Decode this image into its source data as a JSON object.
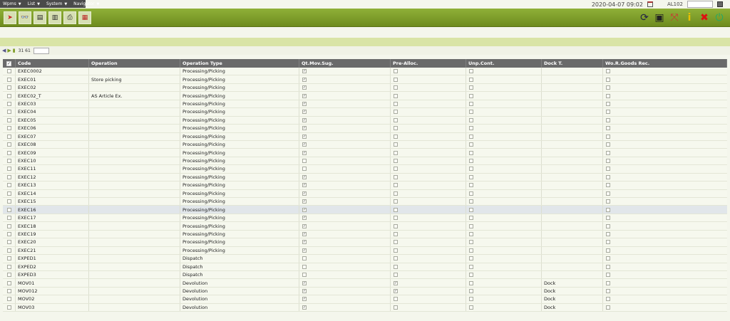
{
  "menu": [
    "Wpms",
    "List",
    "System",
    "Navigator"
  ],
  "header": {
    "datetime": "2020-04-07  09:02",
    "user": "AL102"
  },
  "toolbar": {
    "left": [
      "arrow-icon",
      "glasses-icon",
      "page-icon",
      "page-export-icon",
      "print-icon",
      "flag-icon"
    ],
    "right": [
      "refresh-icon",
      "monitor-icon",
      "fullscreen-icon",
      "info-icon",
      "close-icon",
      "power-icon"
    ]
  },
  "pager": {
    "count": "31 61"
  },
  "columns": [
    "Code",
    "Operation",
    "Operation Type",
    "Qt.Mov.Sug.",
    "Pre-Alloc.",
    "Unp.Cont.",
    "Dock T.",
    "Wo.R.Goods Rec."
  ],
  "rows": [
    {
      "code": "EXEC0002",
      "operation": "",
      "type": "Processing/Picking",
      "qt": true,
      "pre": false,
      "unp": false,
      "dock": "",
      "wo": false
    },
    {
      "code": "EXEC01",
      "operation": "Store picking",
      "type": "Processing/Picking",
      "qt": true,
      "pre": false,
      "unp": false,
      "dock": "",
      "wo": false
    },
    {
      "code": "EXEC02",
      "operation": "",
      "type": "Processing/Picking",
      "qt": true,
      "pre": false,
      "unp": false,
      "dock": "",
      "wo": false
    },
    {
      "code": "EXEC02_T",
      "operation": "AS Article Ex.",
      "type": "Processing/Picking",
      "qt": true,
      "pre": false,
      "unp": false,
      "dock": "",
      "wo": false
    },
    {
      "code": "EXEC03",
      "operation": "",
      "type": "Processing/Picking",
      "qt": true,
      "pre": false,
      "unp": false,
      "dock": "",
      "wo": false
    },
    {
      "code": "EXEC04",
      "operation": "",
      "type": "Processing/Picking",
      "qt": true,
      "pre": false,
      "unp": false,
      "dock": "",
      "wo": false
    },
    {
      "code": "EXEC05",
      "operation": "",
      "type": "Processing/Picking",
      "qt": true,
      "pre": false,
      "unp": false,
      "dock": "",
      "wo": false
    },
    {
      "code": "EXEC06",
      "operation": "",
      "type": "Processing/Picking",
      "qt": true,
      "pre": false,
      "unp": false,
      "dock": "",
      "wo": false
    },
    {
      "code": "EXEC07",
      "operation": "",
      "type": "Processing/Picking",
      "qt": true,
      "pre": false,
      "unp": false,
      "dock": "",
      "wo": false
    },
    {
      "code": "EXEC08",
      "operation": "",
      "type": "Processing/Picking",
      "qt": true,
      "pre": false,
      "unp": false,
      "dock": "",
      "wo": false
    },
    {
      "code": "EXEC09",
      "operation": "",
      "type": "Processing/Picking",
      "qt": true,
      "pre": false,
      "unp": false,
      "dock": "",
      "wo": false
    },
    {
      "code": "EXEC10",
      "operation": "",
      "type": "Processing/Picking",
      "qt": false,
      "pre": false,
      "unp": false,
      "dock": "",
      "wo": false
    },
    {
      "code": "EXEC11",
      "operation": "",
      "type": "Processing/Picking",
      "qt": false,
      "pre": false,
      "unp": false,
      "dock": "",
      "wo": false
    },
    {
      "code": "EXEC12",
      "operation": "",
      "type": "Processing/Picking",
      "qt": true,
      "pre": false,
      "unp": false,
      "dock": "",
      "wo": false
    },
    {
      "code": "EXEC13",
      "operation": "",
      "type": "Processing/Picking",
      "qt": true,
      "pre": false,
      "unp": false,
      "dock": "",
      "wo": false
    },
    {
      "code": "EXEC14",
      "operation": "",
      "type": "Processing/Picking",
      "qt": true,
      "pre": false,
      "unp": false,
      "dock": "",
      "wo": false
    },
    {
      "code": "EXEC15",
      "operation": "",
      "type": "Processing/Picking",
      "qt": true,
      "pre": false,
      "unp": false,
      "dock": "",
      "wo": false
    },
    {
      "code": "EXEC16",
      "operation": "",
      "type": "Processing/Picking",
      "qt": true,
      "pre": false,
      "unp": false,
      "dock": "",
      "wo": false
    },
    {
      "code": "EXEC17",
      "operation": "",
      "type": "Processing/Picking",
      "qt": true,
      "pre": false,
      "unp": false,
      "dock": "",
      "wo": false
    },
    {
      "code": "EXEC18",
      "operation": "",
      "type": "Processing/Picking",
      "qt": true,
      "pre": false,
      "unp": false,
      "dock": "",
      "wo": false
    },
    {
      "code": "EXEC19",
      "operation": "",
      "type": "Processing/Picking",
      "qt": true,
      "pre": false,
      "unp": false,
      "dock": "",
      "wo": false
    },
    {
      "code": "EXEC20",
      "operation": "",
      "type": "Processing/Picking",
      "qt": true,
      "pre": false,
      "unp": false,
      "dock": "",
      "wo": false
    },
    {
      "code": "EXEC21",
      "operation": "",
      "type": "Processing/Picking",
      "qt": true,
      "pre": false,
      "unp": false,
      "dock": "",
      "wo": false
    },
    {
      "code": "EXPED1",
      "operation": "",
      "type": "Dispatch",
      "qt": false,
      "pre": false,
      "unp": false,
      "dock": "",
      "wo": false
    },
    {
      "code": "EXPED2",
      "operation": "",
      "type": "Dispatch",
      "qt": false,
      "pre": false,
      "unp": false,
      "dock": "",
      "wo": false
    },
    {
      "code": "EXPED3",
      "operation": "",
      "type": "Dispatch",
      "qt": false,
      "pre": false,
      "unp": false,
      "dock": "",
      "wo": false
    },
    {
      "code": "MOV01",
      "operation": "",
      "type": "Devolution",
      "qt": true,
      "pre": true,
      "unp": false,
      "dock": "Dock",
      "wo": false
    },
    {
      "code": "MOV012",
      "operation": "",
      "type": "Devolution",
      "qt": true,
      "pre": true,
      "unp": false,
      "dock": "Dock",
      "wo": false
    },
    {
      "code": "MOV02",
      "operation": "",
      "type": "Devolution",
      "qt": true,
      "pre": false,
      "unp": false,
      "dock": "Dock",
      "wo": false
    },
    {
      "code": "MOV03",
      "operation": "",
      "type": "Devolution",
      "qt": true,
      "pre": false,
      "unp": false,
      "dock": "Dock",
      "wo": false
    }
  ],
  "selected_row": "EXEC16"
}
